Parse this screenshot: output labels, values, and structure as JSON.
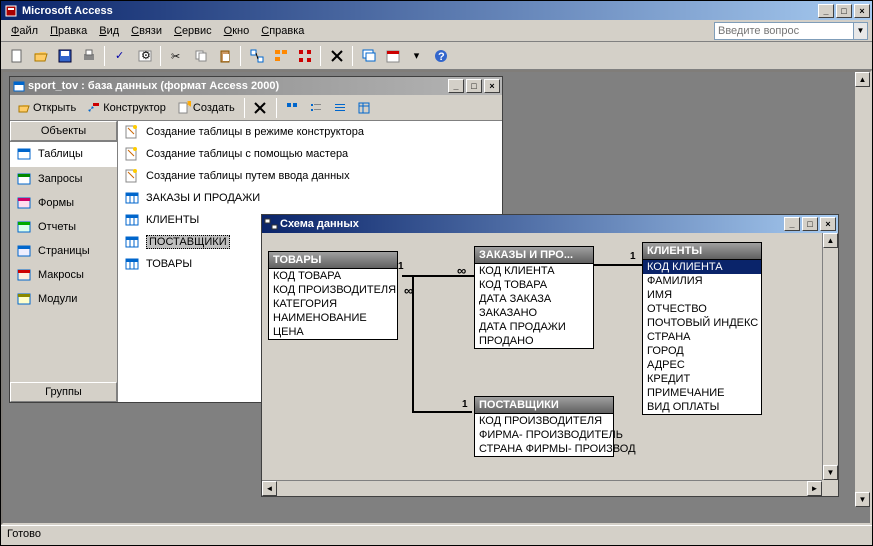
{
  "app_title": "Microsoft Access",
  "menu": [
    "Файл",
    "Правка",
    "Вид",
    "Связи",
    "Сервис",
    "Окно",
    "Справка"
  ],
  "menu_u": [
    0,
    0,
    0,
    0,
    0,
    0,
    0
  ],
  "help_placeholder": "Введите вопрос",
  "status": "Готово",
  "db_window": {
    "title": "sport_tov : база данных (формат Access 2000)",
    "toolbar": {
      "open": "Открыть",
      "design": "Конструктор",
      "new": "Создать"
    },
    "objects_header": "Объекты",
    "groups_header": "Группы",
    "objects": [
      "Таблицы",
      "Запросы",
      "Формы",
      "Отчеты",
      "Страницы",
      "Макросы",
      "Модули"
    ],
    "selected_object": 0,
    "list": [
      "Создание таблицы в режиме конструктора",
      "Создание таблицы с помощью мастера",
      "Создание таблицы путем ввода данных",
      "ЗАКАЗЫ И ПРОДАЖИ",
      "КЛИЕНТЫ",
      "ПОСТАВЩИКИ",
      "ТОВАРЫ"
    ],
    "selected_list": 5
  },
  "schema_window": {
    "title": "Схема данных",
    "tables": {
      "tovary": {
        "title": "ТОВАРЫ",
        "fields": [
          "КОД ТОВАРА",
          "КОД ПРОИЗВОДИТЕЛЯ",
          "КАТЕГОРИЯ",
          "НАИМЕНОВАНИЕ",
          "ЦЕНА"
        ]
      },
      "zakazy": {
        "title": "ЗАКАЗЫ И ПРО...",
        "fields": [
          "КОД КЛИЕНТА",
          "КОД ТОВАРА",
          "ДАТА ЗАКАЗА",
          "ЗАКАЗАНО",
          "ДАТА ПРОДАЖИ",
          "ПРОДАНО"
        ]
      },
      "klienty": {
        "title": "КЛИЕНТЫ",
        "fields": [
          "КОД КЛИЕНТА",
          "ФАМИЛИЯ",
          "ИМЯ",
          "ОТЧЕСТВО",
          "ПОЧТОВЫЙ ИНДЕКС",
          "СТРАНА",
          "ГОРОД",
          "АДРЕС",
          "КРЕДИТ",
          "ПРИМЕЧАНИЕ",
          "ВИД ОПЛАТЫ"
        ],
        "pk": 0
      },
      "postavshiki": {
        "title": "ПОСТАВЩИКИ",
        "fields": [
          "КОД ПРОИЗВОДИТЕЛЯ",
          "ФИРМА- ПРОИЗВОДИТЕЛЬ",
          "СТРАНА ФИРМЫ- ПРОИЗВОД"
        ]
      }
    },
    "labels": {
      "one": "1",
      "inf": "∞"
    }
  }
}
